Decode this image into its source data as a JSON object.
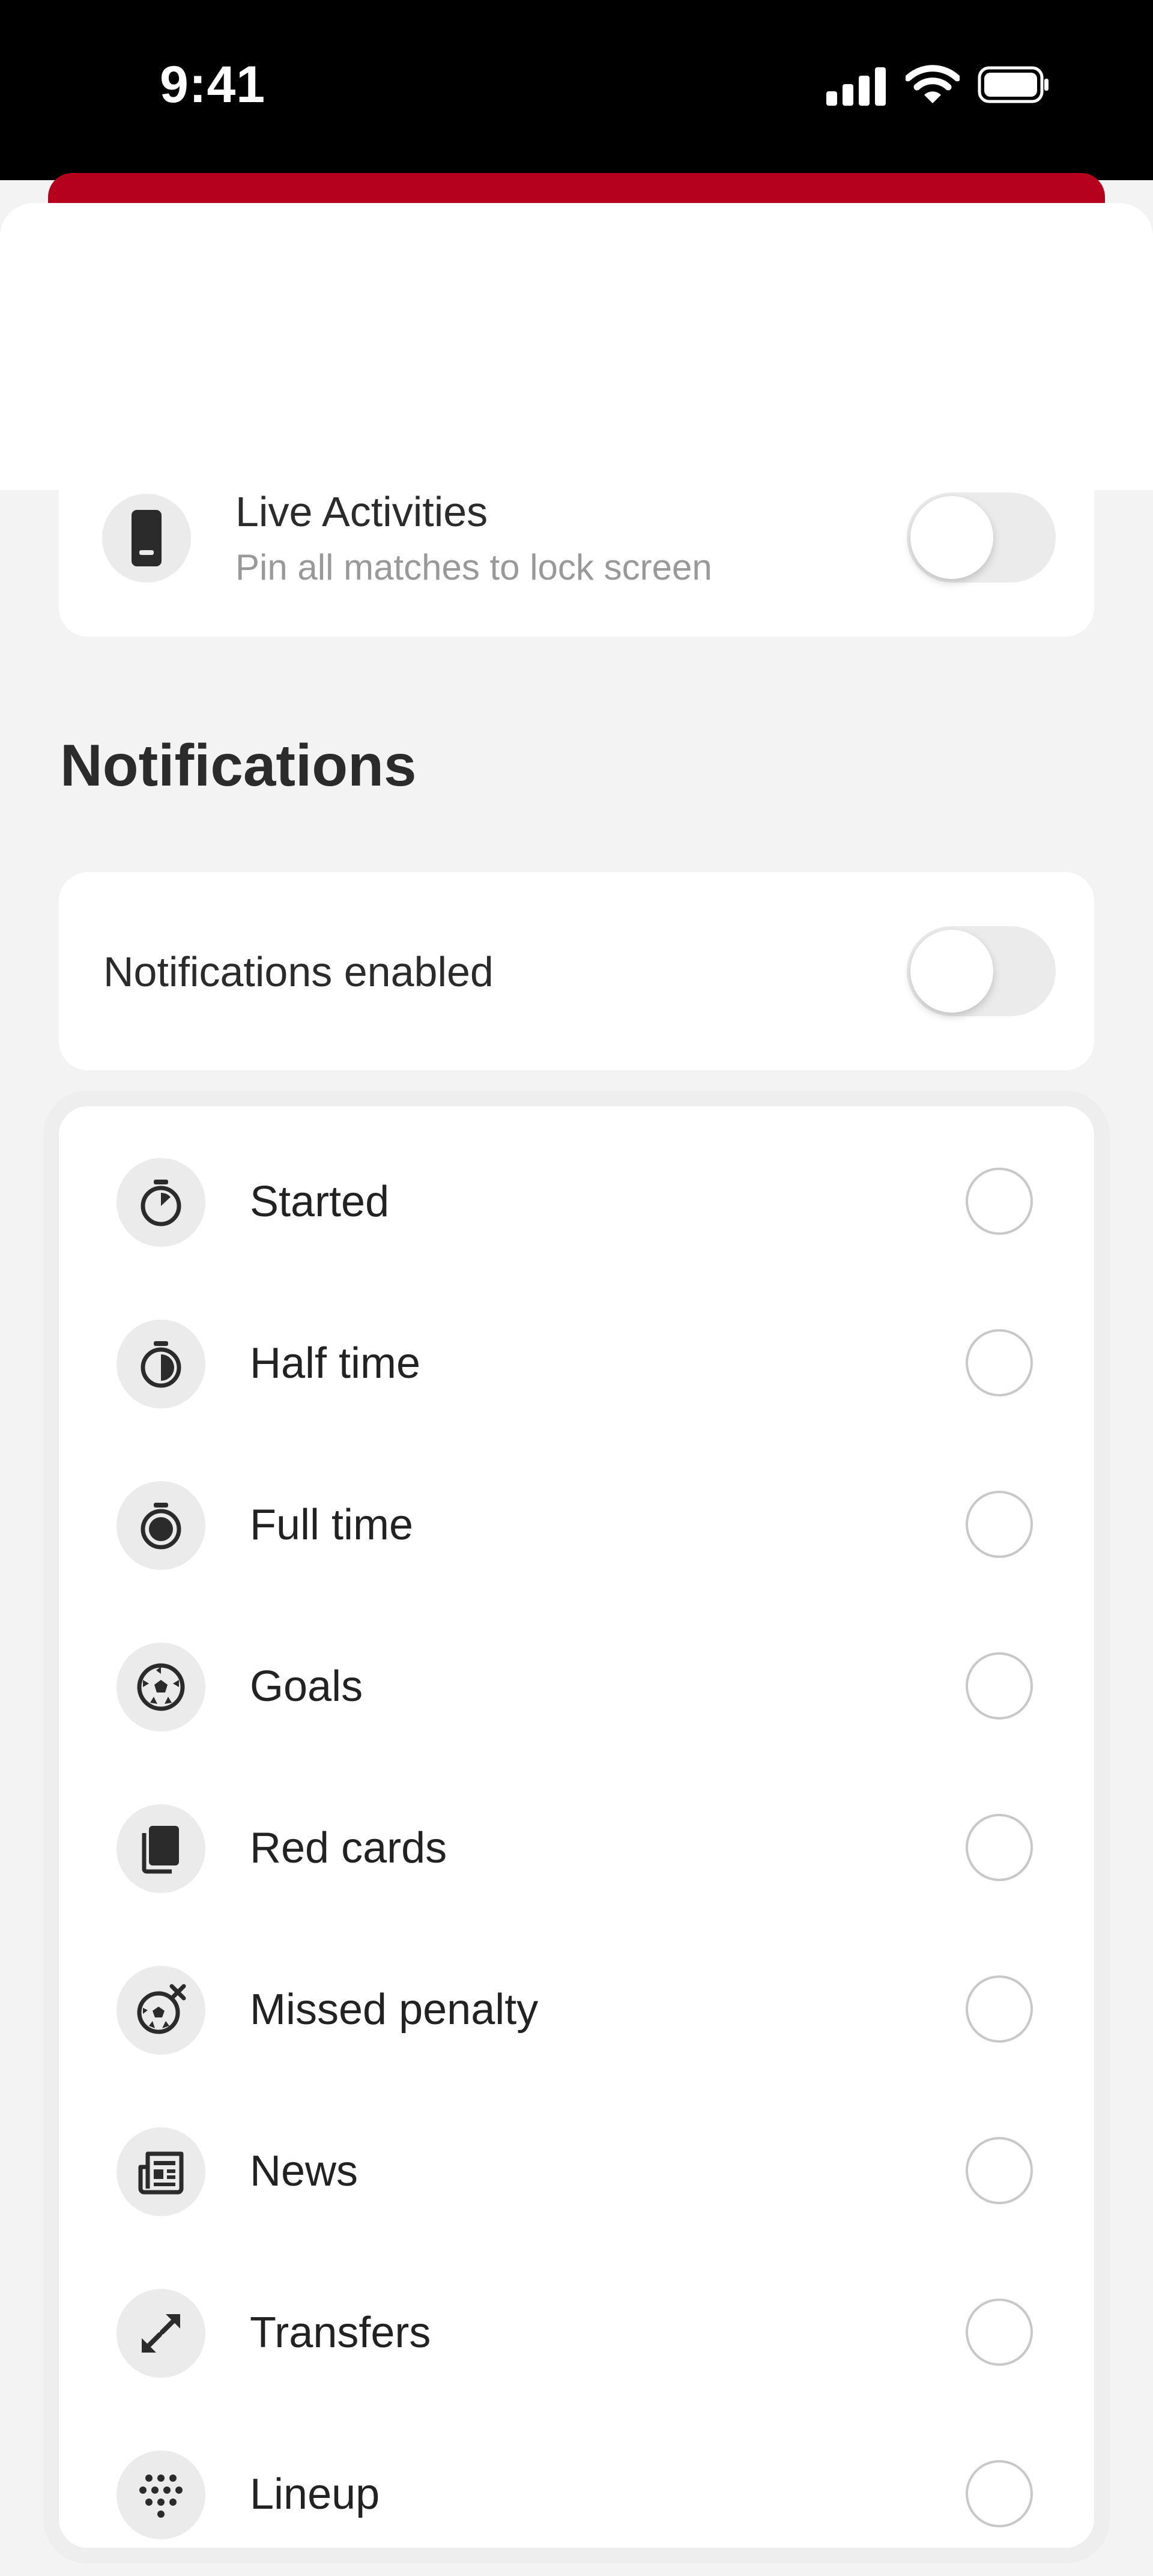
{
  "status_bar": {
    "time": "9:41",
    "icons": [
      "signal-icon",
      "wifi-icon",
      "battery-icon"
    ]
  },
  "colors": {
    "accent": "#b5001e",
    "background": "#f3f3f3",
    "card": "#ffffff",
    "icon_bg": "#ebebeb",
    "muted_text": "#999999"
  },
  "live_activities": {
    "title": "Live Activities",
    "subtitle": "Pin all matches to lock screen",
    "icon": "phone-icon",
    "enabled": false
  },
  "notifications": {
    "section_title": "Notifications",
    "enabled_label": "Notifications enabled",
    "enabled": false,
    "items": [
      {
        "label": "Started",
        "icon": "stopwatch-icon",
        "checked": false
      },
      {
        "label": "Half time",
        "icon": "stopwatch-half-icon",
        "checked": false
      },
      {
        "label": "Full time",
        "icon": "stopwatch-full-icon",
        "checked": false
      },
      {
        "label": "Goals",
        "icon": "football-icon",
        "checked": false
      },
      {
        "label": "Red cards",
        "icon": "card-icon",
        "checked": false
      },
      {
        "label": "Missed penalty",
        "icon": "football-cross-icon",
        "checked": false
      },
      {
        "label": "News",
        "icon": "newspaper-icon",
        "checked": false
      },
      {
        "label": "Transfers",
        "icon": "transfer-arrows-icon",
        "checked": false
      },
      {
        "label": "Lineup",
        "icon": "lineup-dots-icon",
        "checked": false
      }
    ]
  }
}
